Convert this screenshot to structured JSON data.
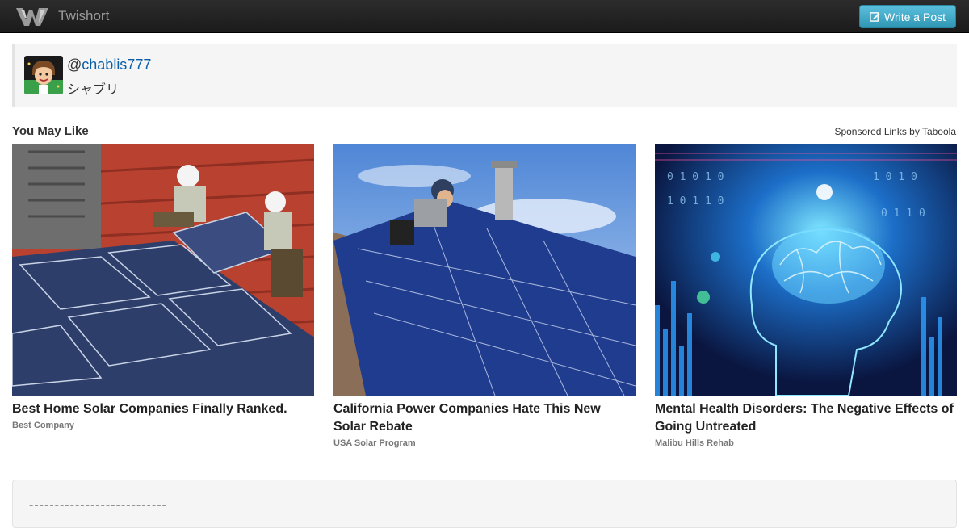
{
  "navbar": {
    "brand": "Twishort",
    "write_button": "Write a Post"
  },
  "profile": {
    "at": "@",
    "handle": "chablis777",
    "name": "シャブリ"
  },
  "recommendations": {
    "heading": "You May Like",
    "sponsored": "Sponsored Links by Taboola",
    "items": [
      {
        "title": "Best Home Solar Companies Finally Ranked.",
        "source": "Best Company"
      },
      {
        "title": "California Power Companies Hate This New Solar Rebate",
        "source": "USA Solar Program"
      },
      {
        "title": "Mental Health Disorders: The Negative Effects of Going Untreated",
        "source": "Malibu Hills Rehab"
      }
    ]
  },
  "post": {
    "text": "---------------------------"
  },
  "colors": {
    "accent": "#2f96b4",
    "link": "#0a5ea8",
    "navbar": "#1b1b1b"
  }
}
